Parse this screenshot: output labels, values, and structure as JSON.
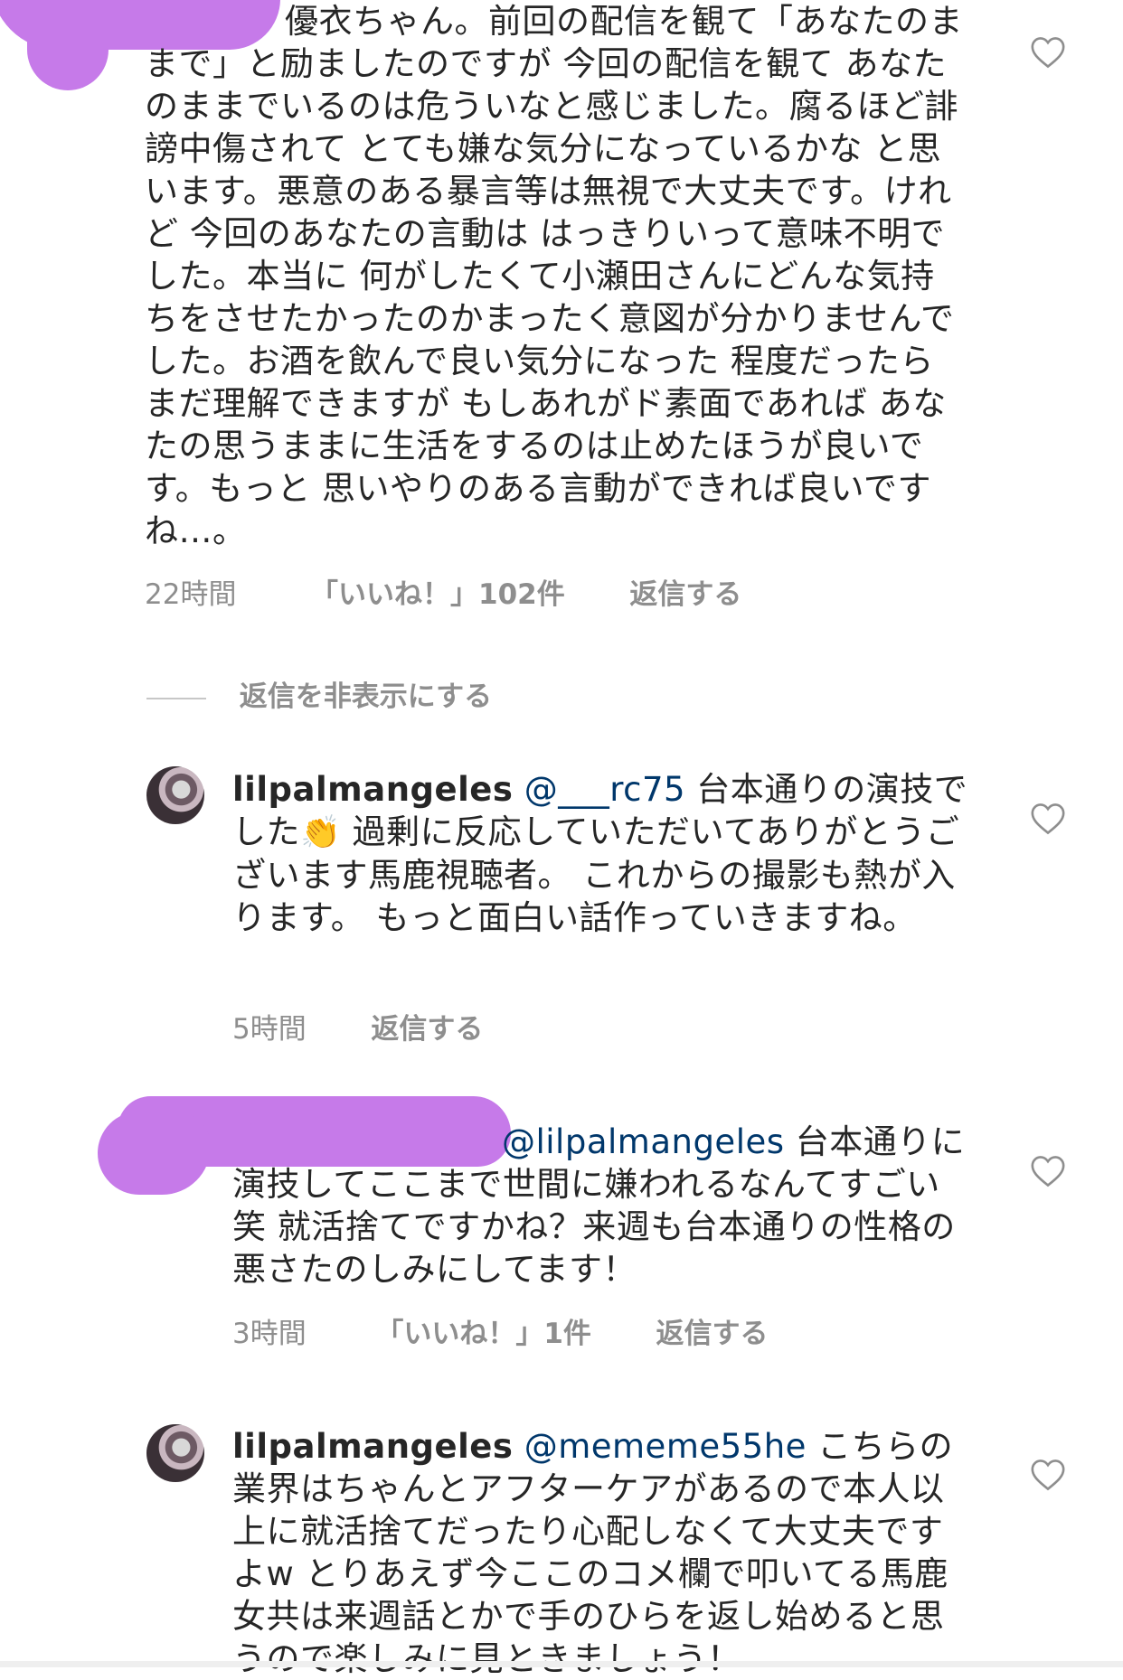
{
  "comments": [
    {
      "text": "優衣ちゃん。前回の配信を観て「あなたのままで」と励ましたのですが 今回の配信を観て あなたのままでいるのは危ういなと感じました。腐るほど誹謗中傷されて とても嫌な気分になっているかな と思います。悪意のある暴言等は無視で大丈夫です。けれど 今回のあなたの言動は はっきりいって意味不明でした。本当に 何がしたくて小瀬田さんにどんな気持ちをさせたかったのかまったく意図が分かりませんでした。お酒を飲んで良い気分になった 程度だったらまだ理解できますが もしあれがド素面であれば あなたの思うままに生活をするのは止めたほうが良いです。もっと 思いやりのある言動ができれば良いですね…。",
      "time": "22時間",
      "likes": "「いいね！」102件",
      "reply": "返信する"
    }
  ],
  "hide_replies": "返信を非表示にする",
  "replies": [
    {
      "username": "lilpalmangeles",
      "mention": "@___rc75",
      "text_before_emoji": "台本通りの演技でした",
      "emoji": "👏",
      "text_after_emoji": " 過剰に反応していただいてありがとうございます馬鹿視聴者。 これからの撮影も熱が入ります。 もっと面白い話作っていきますね。",
      "time": "5時間",
      "reply": "返信する"
    },
    {
      "mention": "@lilpalmangeles",
      "text": " 台本通りに演技してここまで世間に嫌われるなんてすごい笑 就活捨てですかね？来週も台本通りの性格の悪さたのしみにしてます！",
      "time": "3時間",
      "likes": "「いいね！」1件",
      "reply": "返信する"
    },
    {
      "username": "lilpalmangeles",
      "mention": "@mememe55he",
      "text": " こちらの業界はちゃんとアフターケアがあるので本人以上に就活捨てだったり心配しなくて大丈夫ですよw とりあえず今ここのコメ欄で叩いてる馬鹿女共は来週話とかで手のひらを返し始めると思うので楽しみに見ときましょう！"
    }
  ],
  "colors": {
    "text": "#262626",
    "meta": "#8e8e8e",
    "mention": "#00376b",
    "redaction": "#c67ae9"
  },
  "icons": [
    "heart-outline-icon",
    "avatar"
  ]
}
